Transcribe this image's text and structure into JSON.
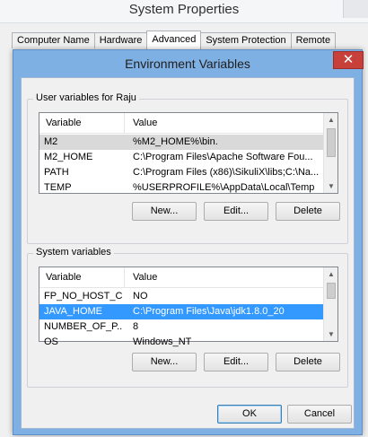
{
  "system_properties": {
    "title": "System Properties",
    "tabs": [
      {
        "label": "Computer Name",
        "active": false
      },
      {
        "label": "Hardware",
        "active": false
      },
      {
        "label": "Advanced",
        "active": true
      },
      {
        "label": "System Protection",
        "active": false
      },
      {
        "label": "Remote",
        "active": false
      }
    ]
  },
  "dialog": {
    "title": "Environment Variables",
    "close_glyph": "✕",
    "user_vars": {
      "group_label": "User variables for Raju",
      "columns": {
        "variable": "Variable",
        "value": "Value"
      },
      "rows": [
        {
          "variable": "M2",
          "value": "%M2_HOME%\\bin.",
          "selected": "gray"
        },
        {
          "variable": "M2_HOME",
          "value": "C:\\Program Files\\Apache Software Fou...",
          "selected": ""
        },
        {
          "variable": "PATH",
          "value": "C:\\Program Files (x86)\\SikuliX\\libs;C:\\Na...",
          "selected": ""
        },
        {
          "variable": "TEMP",
          "value": "%USERPROFILE%\\AppData\\Local\\Temp",
          "selected": ""
        }
      ],
      "buttons": {
        "new": "New...",
        "edit": "Edit...",
        "delete": "Delete"
      }
    },
    "system_vars": {
      "group_label": "System variables",
      "columns": {
        "variable": "Variable",
        "value": "Value"
      },
      "rows": [
        {
          "variable": "FP_NO_HOST_C...",
          "value": "NO",
          "selected": ""
        },
        {
          "variable": "JAVA_HOME",
          "value": "C:\\Program Files\\Java\\jdk1.8.0_20",
          "selected": "blue"
        },
        {
          "variable": "NUMBER_OF_P...",
          "value": "8",
          "selected": ""
        },
        {
          "variable": "OS",
          "value": "Windows_NT",
          "selected": ""
        }
      ],
      "buttons": {
        "new": "New...",
        "edit": "Edit...",
        "delete": "Delete"
      }
    },
    "ok_label": "OK",
    "cancel_label": "Cancel"
  },
  "icons": {
    "scroll_up": "▲",
    "scroll_down": "▼"
  },
  "colors": {
    "selection_blue": "#3399ff",
    "selection_gray": "#d9d9d9",
    "titlebar_blue": "#7fb0e3",
    "close_red": "#c7403a"
  }
}
